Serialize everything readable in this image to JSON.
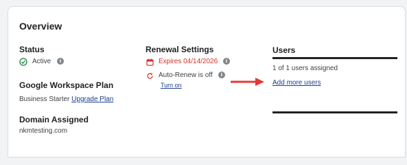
{
  "overview": {
    "title": "Overview",
    "status": {
      "label": "Status",
      "value": "Active",
      "info_icon": "info-icon",
      "status_icon": "check-circle-icon",
      "status_color": "#188038"
    },
    "plan": {
      "label": "Google Workspace Plan",
      "value": "Business Starter",
      "upgrade_link": "Upgrade Plan"
    },
    "domain": {
      "label": "Domain Assigned",
      "value": "nkmtesting.com"
    },
    "renewal": {
      "label": "Renewal Settings",
      "expires": "Expires 04/14/2026",
      "expires_color": "#d93025",
      "auto_renew": "Auto-Renew is off",
      "turn_on_link": "Turn on"
    },
    "users": {
      "tab_label": "Users",
      "assigned": "1 of 1 users assigned",
      "add_link": "Add more users"
    }
  }
}
